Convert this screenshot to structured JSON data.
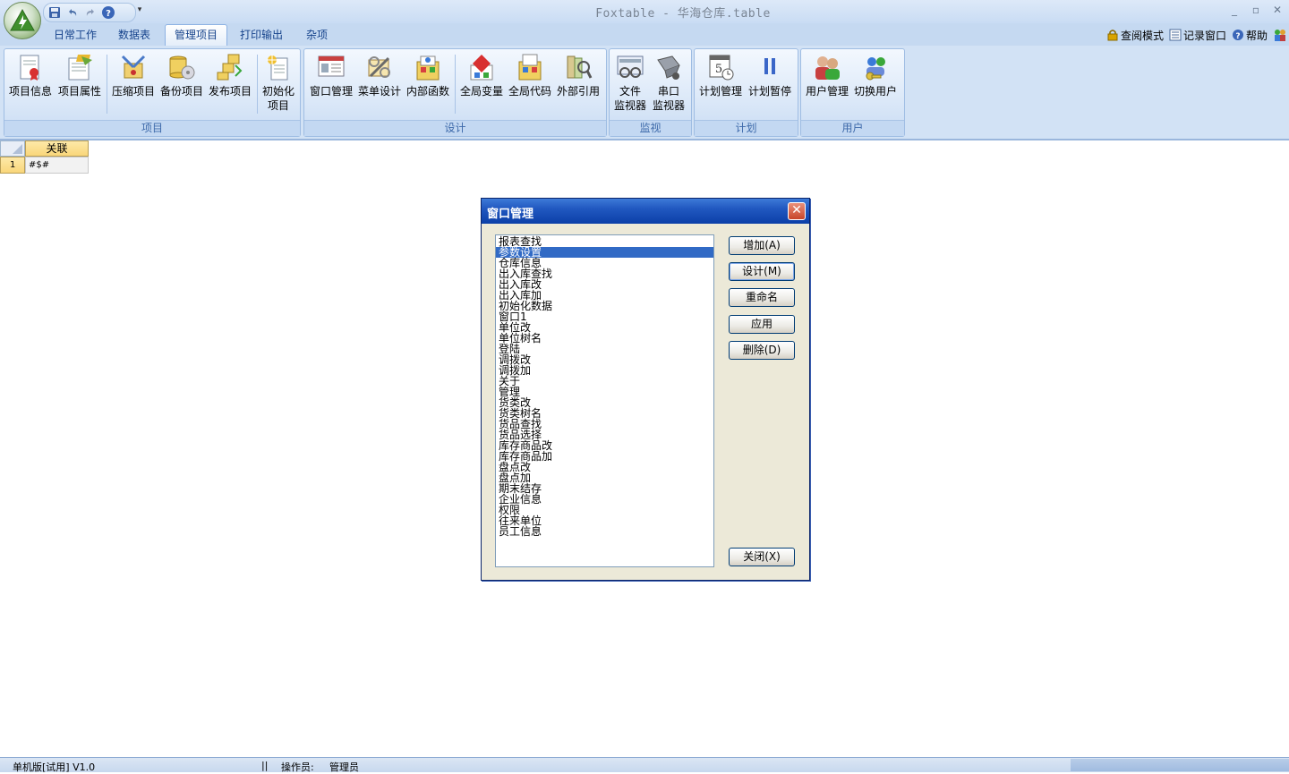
{
  "window": {
    "title": "Foxtable - 华海仓库.table"
  },
  "tabs": [
    {
      "label": "日常工作",
      "active": false
    },
    {
      "label": "数据表",
      "active": false
    },
    {
      "label": "管理项目",
      "active": true
    },
    {
      "label": "打印输出",
      "active": false
    },
    {
      "label": "杂项",
      "active": false
    }
  ],
  "right_tools": {
    "view_mode": "查阅模式",
    "record_window": "记录窗口",
    "help": "帮助"
  },
  "ribbon": {
    "groups": [
      {
        "label": "项目",
        "buttons": [
          "项目信息",
          "项目属性",
          "压缩项目",
          "备份项目",
          "发布项目",
          "初始化",
          "项目"
        ]
      },
      {
        "label": "设计",
        "buttons": [
          "窗口管理",
          "菜单设计",
          "内部函数",
          "全局变量",
          "全局代码",
          "外部引用"
        ]
      },
      {
        "label": "监视",
        "buttons": [
          "文件",
          "监视器",
          "串口",
          "监视器"
        ]
      },
      {
        "label": "计划",
        "buttons": [
          "计划管理",
          "计划暂停"
        ]
      },
      {
        "label": "用户",
        "buttons": [
          "用户管理",
          "切换用户"
        ]
      }
    ]
  },
  "sheet": {
    "column_header": "关联",
    "row_number": "1",
    "cell_value": "#$#"
  },
  "dialog": {
    "title": "窗口管理",
    "items": [
      "报表查找",
      "参数设置",
      "仓库信息",
      "出入库查找",
      "出入库改",
      "出入库加",
      "初始化数据",
      "窗口1",
      "单位改",
      "单位树名",
      "登陆",
      "调拨改",
      "调拨加",
      "关于",
      "管理",
      "货类改",
      "货类树名",
      "货品查找",
      "货品选择",
      "库存商品改",
      "库存商品加",
      "盘点改",
      "盘点加",
      "期末结存",
      "企业信息",
      "权限",
      "往来单位",
      "员工信息"
    ],
    "selected_index": 1,
    "buttons": {
      "add": "增加(A)",
      "design": "设计(M)",
      "rename": "重命名",
      "apply": "应用",
      "delete": "删除(D)",
      "close": "关闭(X)"
    }
  },
  "status": {
    "edition": "单机版[试用] V1.0",
    "separator": "||",
    "operator_label": "操作员:",
    "operator": "管理员"
  }
}
